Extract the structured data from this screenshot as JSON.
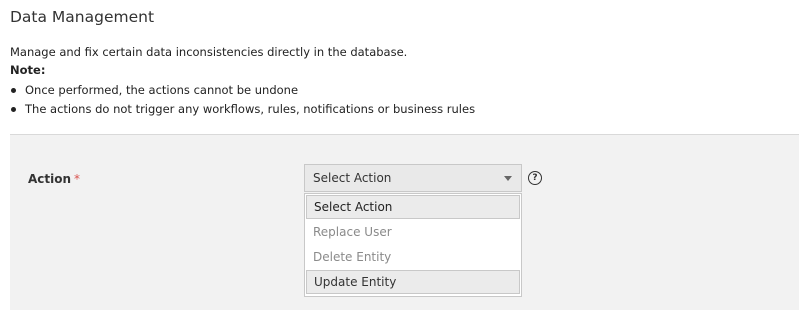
{
  "page": {
    "title": "Data Management",
    "description": "Manage and fix certain data inconsistencies directly in the database.",
    "note_label": "Note:",
    "notes": [
      "Once performed, the actions cannot be undone",
      "The actions do not trigger any workflows, rules, notifications or business rules"
    ]
  },
  "form": {
    "action_label": "Action",
    "required_mark": "*",
    "select": {
      "value": "Select Action",
      "options": [
        "Select Action",
        "Replace User",
        "Delete Entity",
        "Update Entity"
      ],
      "selected_index": 0,
      "hovered_index": 3
    },
    "help_icon": "question-circle-icon",
    "help_glyph": "?"
  },
  "colors": {
    "panel_background": "#f2f2f2",
    "required": "#d9534f",
    "option_disabled_text": "#8a8a8a"
  }
}
